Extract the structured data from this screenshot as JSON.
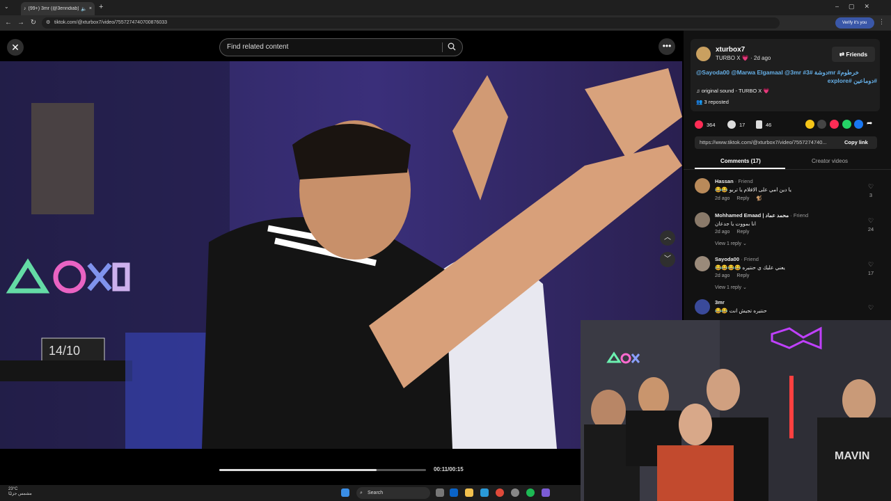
{
  "browser": {
    "tab_title": "(99+) 3mr (@3enndiab) | Ti",
    "url": "tiktok.com/@xturbox7/video/7557274740700876033",
    "verify_label": "Verify it's you"
  },
  "tiktok": {
    "search_placeholder": "Find related content",
    "time": "00:11/00:15",
    "progress": 0.76
  },
  "author": {
    "username": "xturbox7",
    "display_name": "TURBO X",
    "posted": "2d ago",
    "friends_label": "Friends",
    "description_line1": "@Sayoda00 @Marwa Elgamaal @3mr #دوشة #3mr #خرطوم",
    "description_line2": "#دوماعين #explore",
    "sound": "original sound - TURBO X",
    "reposted": "3 reposted"
  },
  "stats": {
    "likes": "364",
    "comments": "17",
    "saves": "46"
  },
  "share": {
    "link": "https://www.tiktok.com/@xturbox7/video/7557274740...",
    "copy_label": "Copy link"
  },
  "tabs": {
    "comments": "Comments (17)",
    "creator": "Creator videos"
  },
  "comments": [
    {
      "name": "Hassan",
      "tag": " · Friend",
      "text": "يا دين امي على الافلام يا تربو 😂😂",
      "date": "2d ago",
      "reply": "Reply",
      "likes": "3",
      "replies": ""
    },
    {
      "name": "Mohhamed Emaad | محمد عماد",
      "tag": " · Friend",
      "text": "انا بمووت يا جدعان",
      "date": "2d ago",
      "reply": "Reply",
      "likes": "24",
      "replies": "View 1 reply"
    },
    {
      "name": "Sayoda00",
      "tag": " · Friend",
      "text": "يعني عليك ي حنتيره 😂😂😂😂",
      "date": "2d ago",
      "reply": "Reply",
      "likes": "17",
      "replies": "View 1 reply"
    },
    {
      "name": "3mr",
      "tag": "",
      "text": "حنتيره تجيش انت 😂😂",
      "date": "",
      "reply": "",
      "likes": "",
      "replies": ""
    }
  ],
  "taskbar": {
    "temp": "23°C",
    "weather": "مشمس جزئيًا",
    "search": "Search"
  },
  "colors": {
    "like": "#fe2c55",
    "link": "#66b0e8"
  }
}
